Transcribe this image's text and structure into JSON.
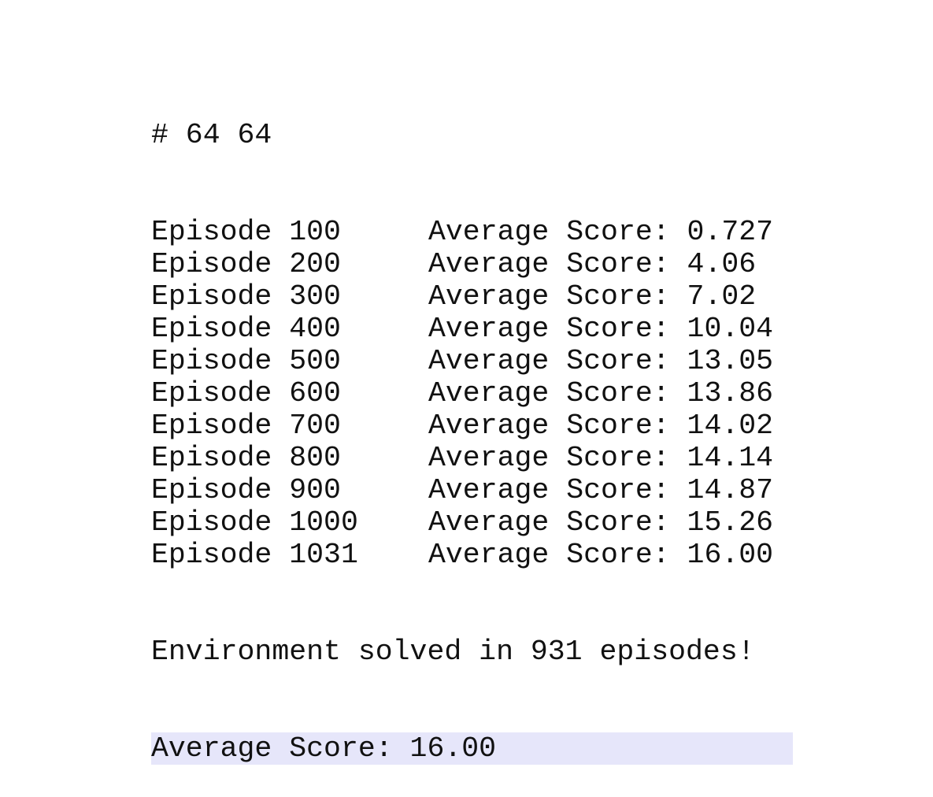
{
  "header_line": "# 64 64",
  "episodes": [
    {
      "episode": "Episode 100",
      "score": "Average Score: 0.727"
    },
    {
      "episode": "Episode 200",
      "score": "Average Score: 4.06"
    },
    {
      "episode": "Episode 300",
      "score": "Average Score: 7.02"
    },
    {
      "episode": "Episode 400",
      "score": "Average Score: 10.04"
    },
    {
      "episode": "Episode 500",
      "score": "Average Score: 13.05"
    },
    {
      "episode": "Episode 600",
      "score": "Average Score: 13.86"
    },
    {
      "episode": "Episode 700",
      "score": "Average Score: 14.02"
    },
    {
      "episode": "Episode 800",
      "score": "Average Score: 14.14"
    },
    {
      "episode": "Episode 900",
      "score": "Average Score: 14.87"
    },
    {
      "episode": "Episode 1000",
      "score": "Average Score: 15.26"
    },
    {
      "episode": "Episode 1031",
      "score": "Average Score: 16.00"
    }
  ],
  "solved_line": "Environment solved in 931 episodes!",
  "final_line": "Average Score: 16.00",
  "colors": {
    "highlight": "#e6e6fa",
    "text": "#111111"
  }
}
